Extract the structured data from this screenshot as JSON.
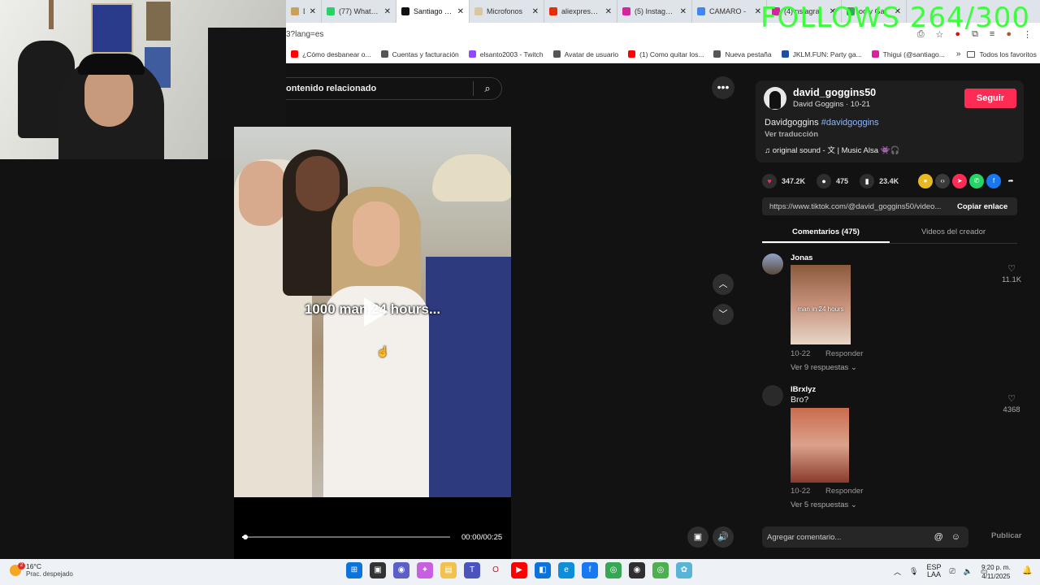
{
  "overlay": {
    "follows_text": "FOLLOWS 264/300"
  },
  "browser": {
    "tabs": [
      {
        "label": "D",
        "color": "#c8a15a",
        "active": false
      },
      {
        "label": "(77) WhatsA",
        "color": "#25d366",
        "active": false
      },
      {
        "label": "Santiago Ce",
        "color": "#111111",
        "active": true
      },
      {
        "label": "Microfonos",
        "color": "#d9c7a0",
        "active": false
      },
      {
        "label": "aliexpress.co",
        "color": "#e62e04",
        "active": false
      },
      {
        "label": "(5) Instagran",
        "color": "#d6249f",
        "active": false
      },
      {
        "label": "CAMARO -",
        "color": "#4285f4",
        "active": false
      },
      {
        "label": "(4) ns agra",
        "color": "#d6249f",
        "active": false
      },
      {
        "label": "oo y Ga",
        "color": "#34a853",
        "active": false
      }
    ],
    "url": "3?lang=es",
    "bookmarks": [
      {
        "label": "¿Cómo desbanear o...",
        "color": "#ff0000"
      },
      {
        "label": "Cuentas y facturación",
        "color": "#555555"
      },
      {
        "label": "elsanto2003 - Twitch",
        "color": "#9146ff"
      },
      {
        "label": "Avatar de usuario",
        "color": "#555555"
      },
      {
        "label": "(1) Como quitar los...",
        "color": "#ff0000"
      },
      {
        "label": "Nueva pestaña",
        "color": "#555555"
      },
      {
        "label": "JKLM.FUN: Party ga...",
        "color": "#1f4e9e"
      },
      {
        "label": "Thigui (@santiago...",
        "color": "#d6249f"
      }
    ],
    "bookmarks_more": "»",
    "all_bookmarks": "Todos los favoritos"
  },
  "player": {
    "related_search": "ontenido relacionado",
    "caption": "1000 man 24 hours...",
    "time": "00:00/00:25",
    "progress": 0.01
  },
  "post": {
    "username": "david_goggins50",
    "subname": "David Goggins · 10-21",
    "follow_label": "Seguir",
    "description": "Davidgoggins",
    "hashtag": "#davidgoggins",
    "translate": "Ver traducción",
    "sound": "original sound - 文 | Music Alsa 👾🎧",
    "likes": "347.2K",
    "comments_count": "475",
    "saves": "23.4K",
    "link": "https://www.tiktok.com/@david_goggins50/video...",
    "copy_link": "Copiar enlace",
    "tab_comments": "Comentarios (475)",
    "tab_creator": "Videos del creador"
  },
  "comments": [
    {
      "user": "Jonas",
      "text": "",
      "image_caption": "man in 24 hours",
      "date": "10-22",
      "reply": "Responder",
      "more": "Ver 9 respuestas ⌄",
      "likes": "11.1K",
      "avatar_color": "#6a7fa8"
    },
    {
      "user": "IBrxlyz",
      "text": "Bro?",
      "image_caption": "",
      "date": "10-22",
      "reply": "Responder",
      "more": "Ver 5 respuestas ⌄",
      "likes": "4368",
      "avatar_color": "#3a3a3a"
    }
  ],
  "comment_input": {
    "placeholder": "Agregar comentario...",
    "publish": "Publicar"
  },
  "taskbar": {
    "weather_temp": "16°C",
    "weather_desc": "Prac. despejado",
    "weather_badge": "2",
    "lang_top": "ESP",
    "lang_bottom": "LAA",
    "time": "9:20 p. m.",
    "date": "4/11/2025"
  }
}
